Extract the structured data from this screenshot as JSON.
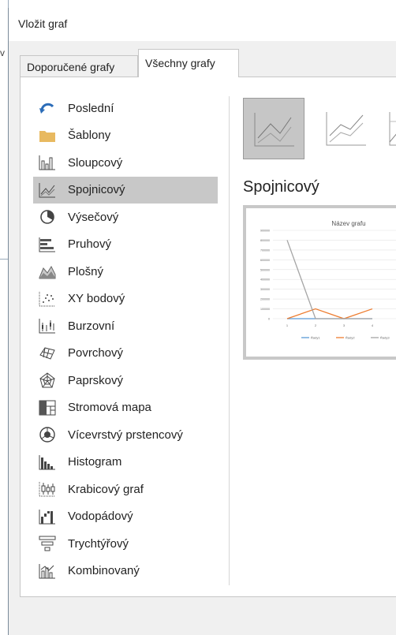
{
  "background": {
    "cut_label": "v"
  },
  "dialog": {
    "title": "Vložit graf",
    "tabs": [
      {
        "label": "Doporučené grafy",
        "active": false
      },
      {
        "label": "Všechny grafy",
        "active": true
      }
    ],
    "chart_types": [
      {
        "label": "Poslední",
        "icon": "recent-icon",
        "selected": false
      },
      {
        "label": "Šablony",
        "icon": "folder-icon",
        "selected": false
      },
      {
        "label": "Sloupcový",
        "icon": "column-chart-icon",
        "selected": false
      },
      {
        "label": "Spojnicový",
        "icon": "line-chart-icon",
        "selected": true
      },
      {
        "label": "Výsečový",
        "icon": "pie-chart-icon",
        "selected": false
      },
      {
        "label": "Pruhový",
        "icon": "bar-chart-icon",
        "selected": false
      },
      {
        "label": "Plošný",
        "icon": "area-chart-icon",
        "selected": false
      },
      {
        "label": "XY bodový",
        "icon": "scatter-chart-icon",
        "selected": false
      },
      {
        "label": "Burzovní",
        "icon": "stock-chart-icon",
        "selected": false
      },
      {
        "label": "Povrchový",
        "icon": "surface-chart-icon",
        "selected": false
      },
      {
        "label": "Paprskový",
        "icon": "radar-chart-icon",
        "selected": false
      },
      {
        "label": "Stromová mapa",
        "icon": "treemap-icon",
        "selected": false
      },
      {
        "label": "Vícevrstvý prstencový",
        "icon": "sunburst-icon",
        "selected": false
      },
      {
        "label": "Histogram",
        "icon": "histogram-icon",
        "selected": false
      },
      {
        "label": "Krabicový graf",
        "icon": "box-whisker-icon",
        "selected": false
      },
      {
        "label": "Vodopádový",
        "icon": "waterfall-icon",
        "selected": false
      },
      {
        "label": "Trychtýřový",
        "icon": "funnel-icon",
        "selected": false
      },
      {
        "label": "Kombinovaný",
        "icon": "combo-chart-icon",
        "selected": false
      }
    ],
    "subtype_heading": "Spojnicový",
    "preview": {
      "title": "Název grafu",
      "y_ticks": [
        "900000",
        "800000",
        "700000",
        "600000",
        "500000",
        "400000",
        "300000",
        "200000",
        "100000",
        "0"
      ],
      "x_ticks": [
        "1",
        "2",
        "3",
        "4"
      ],
      "legend": [
        "Řady1",
        "Řady2",
        "Řady3"
      ],
      "colors": {
        "series1": "#5b9bd5",
        "series2": "#ed7d31",
        "series3": "#a5a5a5"
      }
    }
  },
  "chart_data": {
    "type": "line",
    "title": "Název grafu",
    "categories": [
      "1",
      "2",
      "3",
      "4"
    ],
    "ylim": [
      0,
      900000
    ],
    "series": [
      {
        "name": "Řady1",
        "values": [
          0,
          0,
          0,
          0
        ]
      },
      {
        "name": "Řady2",
        "values": [
          0,
          100000,
          0,
          100000
        ]
      },
      {
        "name": "Řady3",
        "values": [
          800000,
          0,
          0,
          0
        ]
      }
    ]
  }
}
